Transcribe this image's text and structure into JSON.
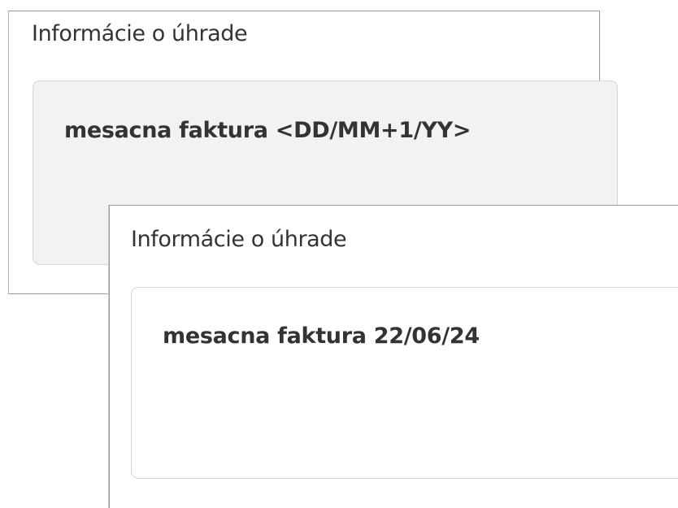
{
  "back_panel": {
    "label": "Informácie o úhrade",
    "value": "mesacna faktura <DD/MM+1/YY>"
  },
  "front_panel": {
    "label": "Informácie o úhrade",
    "value": "mesacna faktura 22/06/24"
  },
  "colors": {
    "text": "#333333",
    "template_field_bg": "#f2f2f2",
    "result_field_bg": "#ffffff",
    "field_border": "#d4d4d4"
  }
}
